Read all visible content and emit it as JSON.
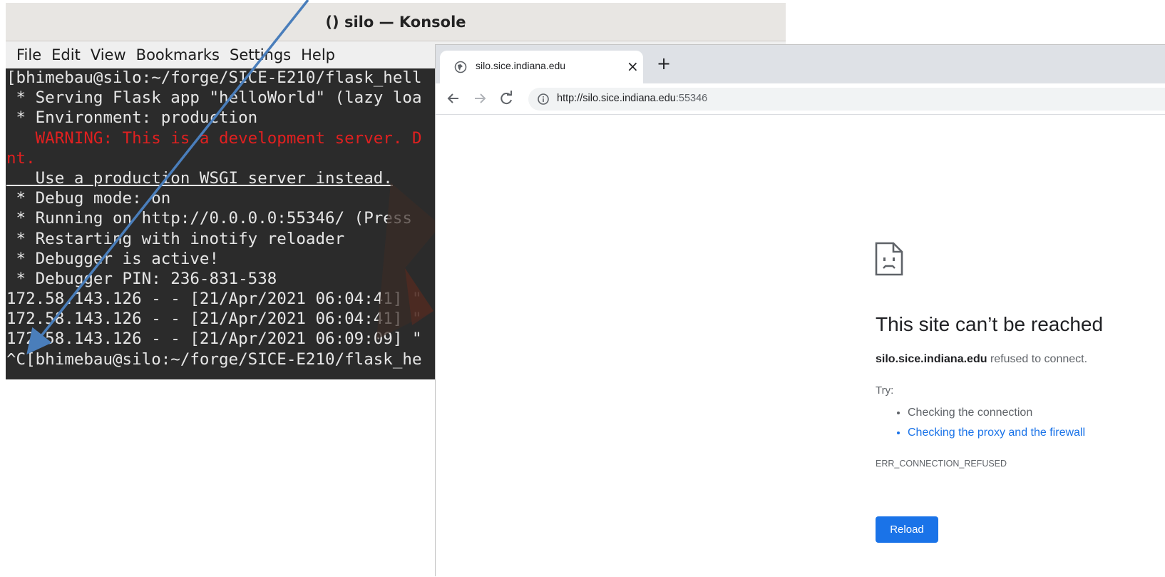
{
  "konsole": {
    "title": "() silo — Konsole",
    "menu": [
      "File",
      "Edit",
      "View",
      "Bookmarks",
      "Settings",
      "Help"
    ],
    "lines": [
      {
        "text": "[bhimebau@silo:~/forge/SICE-E210/flask_hell",
        "style": "normal"
      },
      {
        "text": " * Serving Flask app \"helloWorld\" (lazy loa",
        "style": "normal"
      },
      {
        "text": " * Environment: production",
        "style": "normal"
      },
      {
        "text": "   WARNING: This is a development server. D",
        "style": "red"
      },
      {
        "text": "nt.",
        "style": "red"
      },
      {
        "text": "   Use a production WSGI server instead.",
        "style": "underline"
      },
      {
        "text": " * Debug mode: on",
        "style": "normal"
      },
      {
        "text": " * Running on http://0.0.0.0:55346/ (Press ",
        "style": "normal"
      },
      {
        "text": " * Restarting with inotify reloader",
        "style": "normal"
      },
      {
        "text": " * Debugger is active!",
        "style": "normal"
      },
      {
        "text": " * Debugger PIN: 236-831-538",
        "style": "normal"
      },
      {
        "text": "172.58.143.126 - - [21/Apr/2021 06:04:41] \"",
        "style": "normal"
      },
      {
        "text": "172.58.143.126 - - [21/Apr/2021 06:04:41] \"",
        "style": "normal"
      },
      {
        "text": "172.58.143.126 - - [21/Apr/2021 06:09:09] \"",
        "style": "normal"
      },
      {
        "text": "^C[bhimebau@silo:~/forge/SICE-E210/flask_he",
        "style": "normal"
      }
    ]
  },
  "chrome": {
    "tab": {
      "title": "silo.sice.indiana.edu",
      "close": "×",
      "icon": "globe-icon"
    },
    "new_tab": "+",
    "url": {
      "host": "http://silo.sice.indiana.edu",
      "port": ":55346"
    },
    "error": {
      "title": "This site can’t be reached",
      "host": "silo.sice.indiana.edu",
      "message": " refused to connect.",
      "try_label": "Try:",
      "suggestions": [
        "Checking the connection",
        "Checking the proxy and the firewall"
      ],
      "code": "ERR_CONNECTION_REFUSED",
      "reload_label": "Reload"
    }
  },
  "colors": {
    "terminal_bg": "#2b2b2b",
    "warning_red": "#e02020",
    "link_blue": "#1a73e8",
    "arrow": "#4a7ebb"
  }
}
